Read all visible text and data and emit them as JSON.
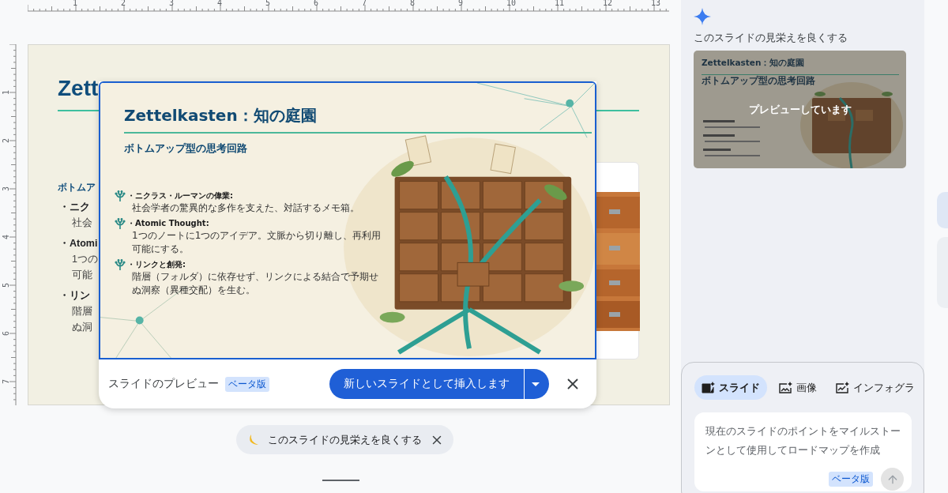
{
  "ruler": {
    "top_marks": [
      "1",
      "2",
      "3",
      "4",
      "5",
      "6",
      "7",
      "8",
      "9",
      "10",
      "11",
      "12",
      "13"
    ],
    "side_marks": [
      "1",
      "2",
      "3",
      "4",
      "5",
      "6",
      "7"
    ]
  },
  "slide": {
    "title": "Zett",
    "heading": "ボトムア",
    "lines": [
      {
        "kind": "bullet",
        "text": "・ニク"
      },
      {
        "kind": "body",
        "text": "社会"
      },
      {
        "kind": "bullet",
        "text": "・Atomi"
      },
      {
        "kind": "body",
        "text": "1つの"
      },
      {
        "kind": "body",
        "text": "可能"
      },
      {
        "kind": "bullet",
        "text": "・リン"
      },
      {
        "kind": "body",
        "text": "階層"
      },
      {
        "kind": "body",
        "text": "ぬ洞"
      }
    ]
  },
  "preview": {
    "title": "Zettelkasten：知の庭園",
    "subtitle": "ボトムアップ型の思考回路",
    "bullets": [
      {
        "heading": "・ニクラス・ルーマンの偉業:",
        "body": "社会学者の驚異的な多作を支えた、対話するメモ箱。"
      },
      {
        "heading": "・Atomic Thought:",
        "body": "1つのノートに1つのアイデア。文脈から切り離し、再利用可能にする。"
      },
      {
        "heading": "・リンクと創発:",
        "body": "階層（フォルダ）に依存せず、リンクによる結合で予期せぬ洞察（異種交配）を生む。"
      }
    ],
    "label": "スライドのプレビュー",
    "badge": "ベータ版",
    "insert_button": "新しいスライドとして挿入します"
  },
  "chip": {
    "label": "このスライドの見栄えを良くする"
  },
  "side_panel": {
    "heading": "このスライドの見栄えを良くする",
    "thumbnail": {
      "title": "Zettelkasten：知の庭園",
      "subtitle": "ボトムアップ型の思考回路",
      "status": "プレビューしています"
    },
    "tabs": [
      {
        "label": "スライド",
        "selected": true
      },
      {
        "label": "画像",
        "selected": false
      },
      {
        "label": "インフォグラ",
        "selected": false
      }
    ],
    "prompt": {
      "placeholder": "現在のスライドのポイントをマイルストーンとして使用してロードマップを作成"
    },
    "badge": "ベータ版",
    "send_button": {
      "disabled": true
    }
  }
}
